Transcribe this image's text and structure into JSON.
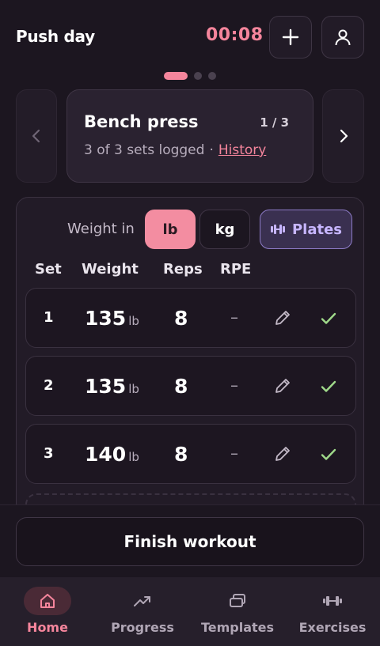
{
  "header": {
    "title": "Push day",
    "timer": "00:08"
  },
  "exercise": {
    "name": "Bench press",
    "position": "1 / 3",
    "sets_summary": "3 of 3 sets logged",
    "separator": "·",
    "history_link": "History"
  },
  "units": {
    "label": "Weight in",
    "lb": "lb",
    "kg": "kg",
    "selected": "lb",
    "plates": "Plates"
  },
  "columns": {
    "set": "Set",
    "weight": "Weight",
    "reps": "Reps",
    "rpe": "RPE"
  },
  "sets": [
    {
      "set": "1",
      "weight": "135",
      "unit": "lb",
      "reps": "8",
      "rpe": "–"
    },
    {
      "set": "2",
      "weight": "135",
      "unit": "lb",
      "reps": "8",
      "rpe": "–"
    },
    {
      "set": "3",
      "weight": "140",
      "unit": "lb",
      "reps": "8",
      "rpe": "–"
    }
  ],
  "finish_label": "Finish workout",
  "nav": [
    {
      "label": "Home",
      "icon": "home-icon",
      "active": true
    },
    {
      "label": "Progress",
      "icon": "trending-up-icon",
      "active": false
    },
    {
      "label": "Templates",
      "icon": "templates-icon",
      "active": false
    },
    {
      "label": "Exercises",
      "icon": "dumbbell-icon",
      "active": false
    }
  ],
  "colors": {
    "accent": "#f5859c",
    "background": "#1c1620",
    "success": "#9fd98a",
    "plates": "#c7b6ff"
  }
}
